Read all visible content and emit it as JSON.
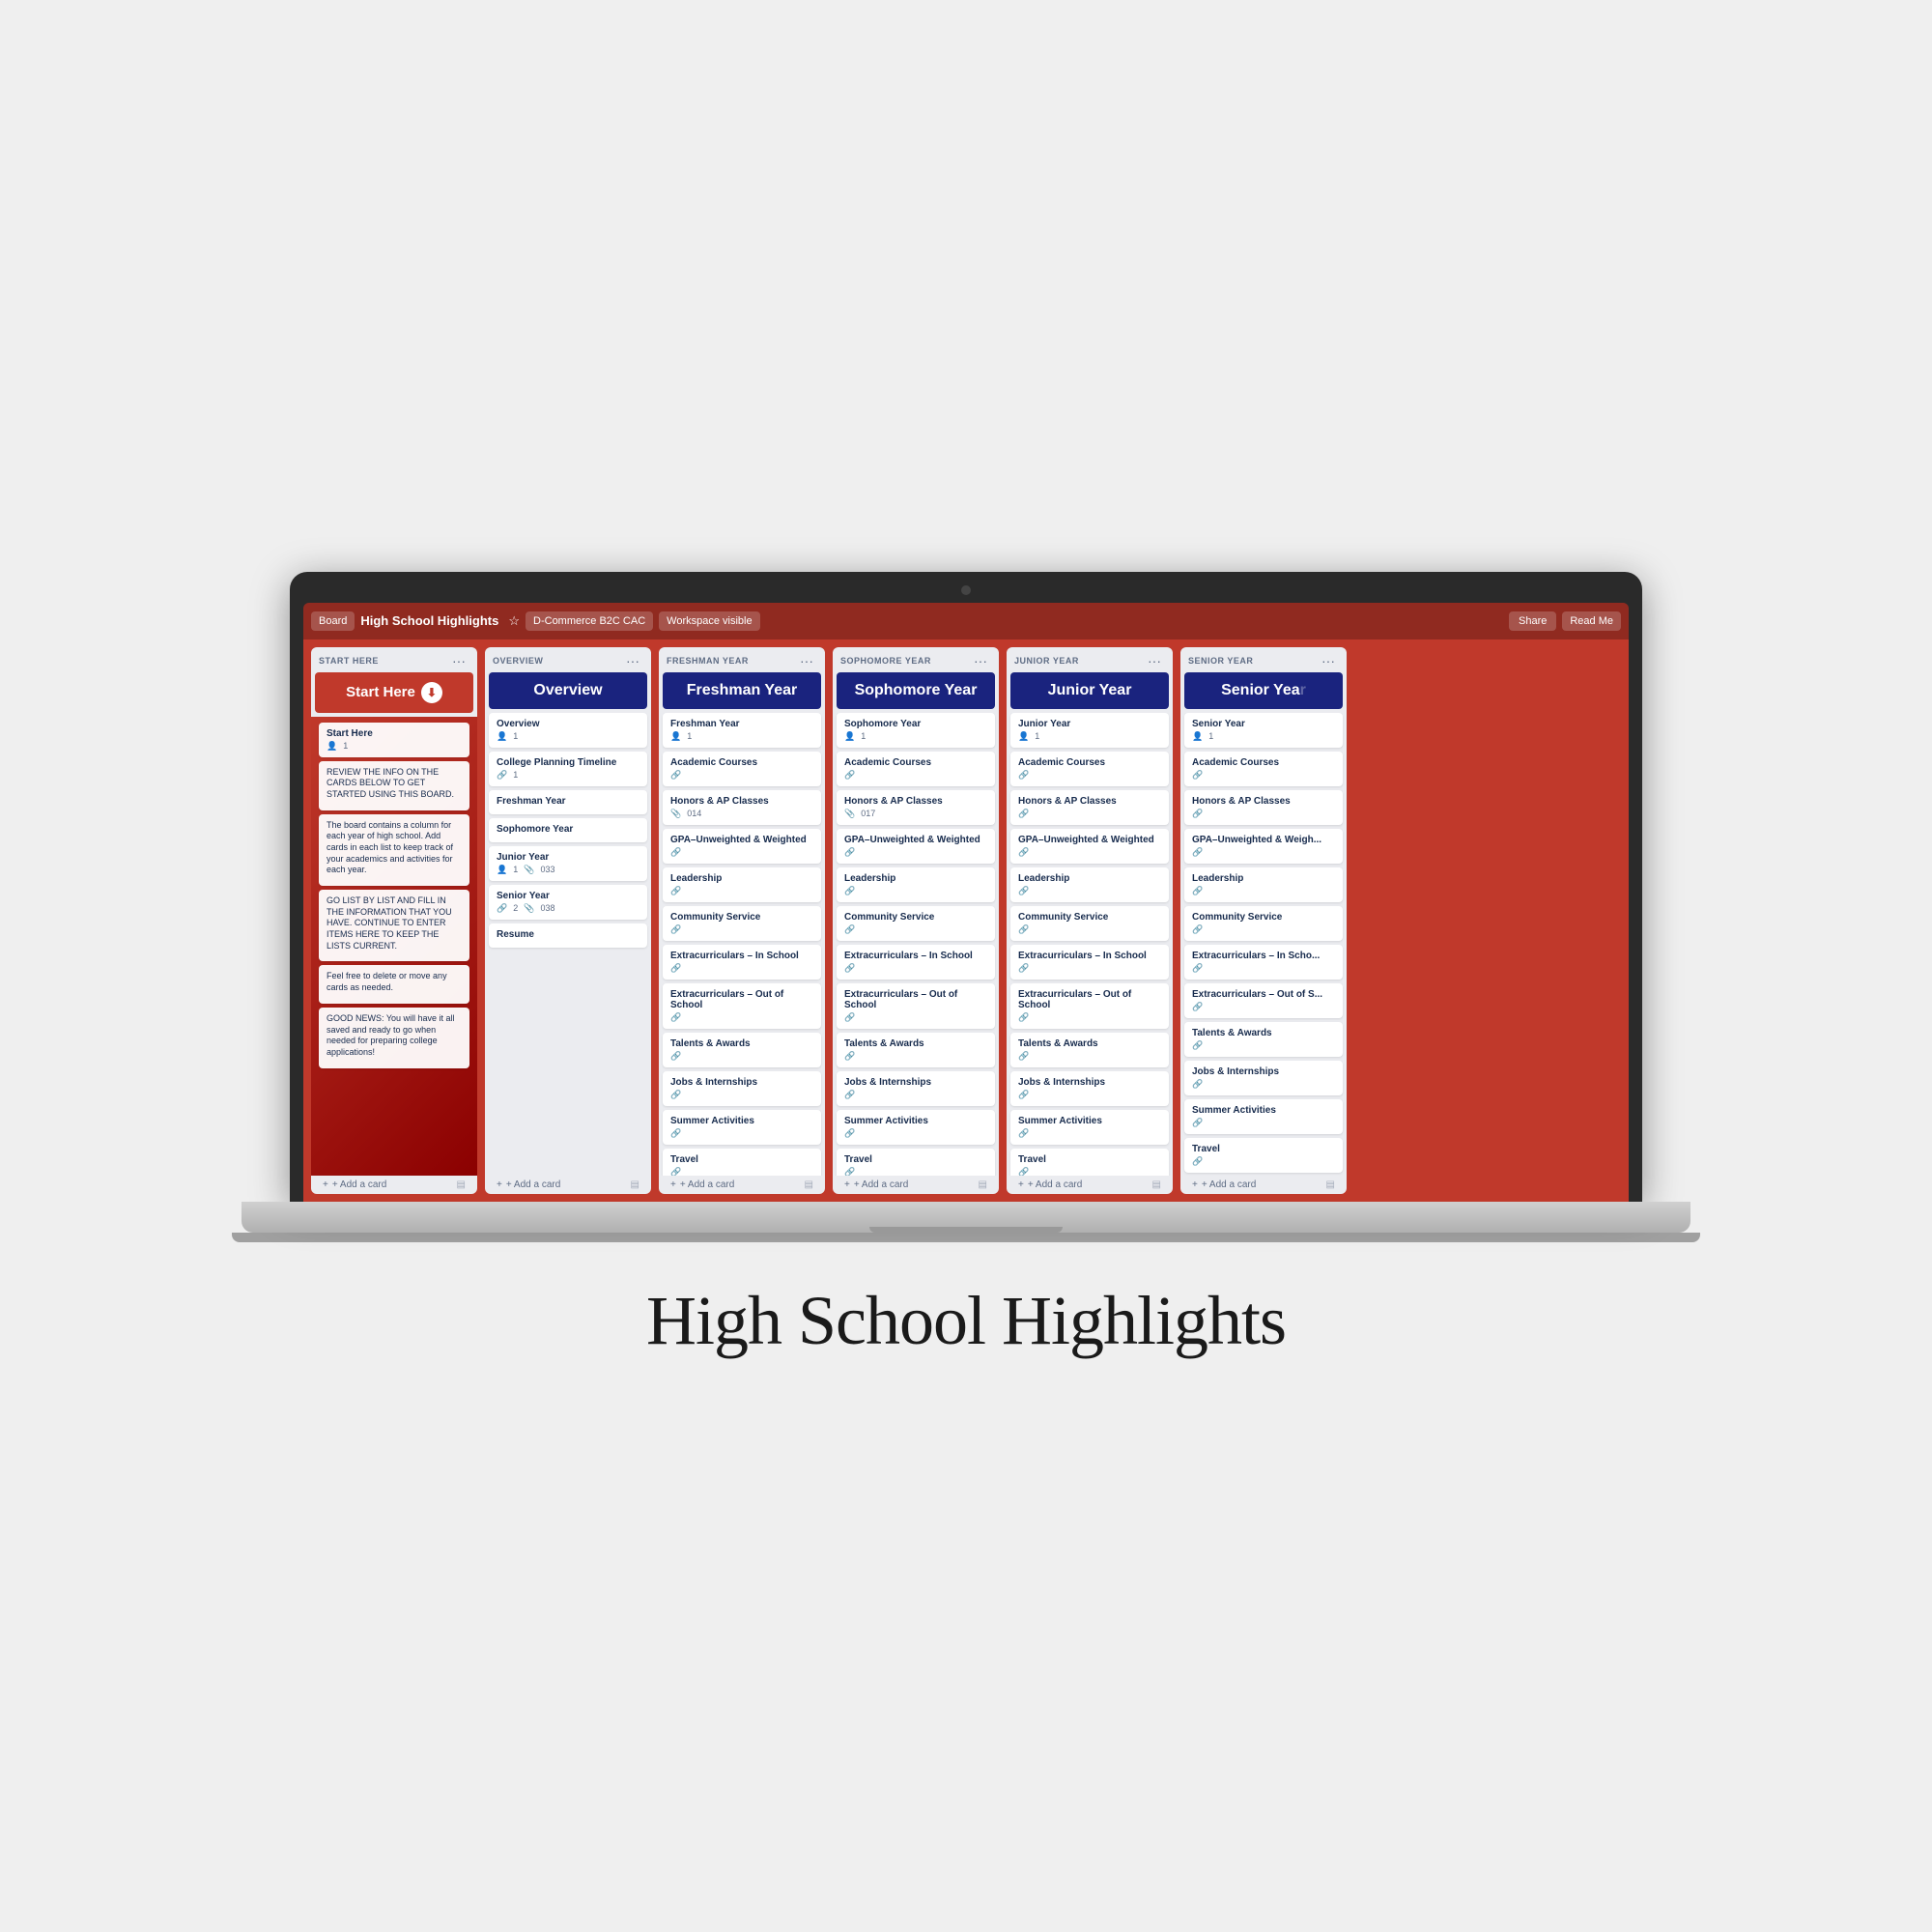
{
  "page": {
    "title": "High School Highlights",
    "background": "#efefef"
  },
  "topbar": {
    "board_btn": "Board",
    "board_title": "High School Highlights",
    "workspace_btn": "D-Commerce B2C CAC",
    "visibility_btn": "Workspace visible",
    "share_btn": "Share",
    "read_btn": "Read Me"
  },
  "columns": [
    {
      "id": "start-here",
      "label": "START HERE",
      "title": "Start Here",
      "title_icon": "⬇",
      "cards": [
        {
          "title": "Start Here",
          "meta": "1"
        },
        {
          "title": "REVIEW THE INFO ON THE CARDS BELOW TO GET STARTED USING THIS BOARD.",
          "body": true
        },
        {
          "title": "The board contains a column for each year of high school. Add cards in each list to keep track of your academics and activities for each year.",
          "body": true
        },
        {
          "title": "GO LIST BY LIST AND FILL IN THE INFORMATION THAT YOU HAVE. CONTINUE TO ENTER ITEMS HERE TO KEEP THE LISTS CURRENT.",
          "body": true
        },
        {
          "title": "Feel free to delete or move any cards as needed.",
          "body": true
        },
        {
          "title": "GOOD NEWS: You will have it all saved and ready to go when needed for preparing college applications!",
          "body": true
        }
      ]
    },
    {
      "id": "overview",
      "label": "OVERVIEW",
      "title": "Overview",
      "cards": [
        {
          "title": "Overview",
          "meta": "1"
        },
        {
          "title": "College Planning Timeline",
          "meta": "1"
        },
        {
          "title": "Freshman Year",
          "meta": ""
        },
        {
          "title": "Sophomore Year",
          "meta": ""
        },
        {
          "title": "Junior Year",
          "meta": "1 033"
        },
        {
          "title": "Senior Year",
          "meta": "2 038"
        },
        {
          "title": "Resume",
          "meta": ""
        }
      ]
    },
    {
      "id": "freshman",
      "label": "FRESHMAN YEAR",
      "title": "Freshman Year",
      "cards": [
        {
          "title": "Freshman Year",
          "meta": "1"
        },
        {
          "title": "Academic Courses",
          "meta": ""
        },
        {
          "title": "Honors & AP Classes",
          "meta": "014"
        },
        {
          "title": "GPA–Unweighted & Weighted",
          "meta": ""
        },
        {
          "title": "Leadership",
          "meta": ""
        },
        {
          "title": "Community Service",
          "meta": ""
        },
        {
          "title": "Extracurriculars – In School",
          "meta": ""
        },
        {
          "title": "Extracurriculars – Out of School",
          "meta": ""
        },
        {
          "title": "Talents & Awards",
          "meta": ""
        },
        {
          "title": "Jobs & Internships",
          "meta": ""
        },
        {
          "title": "Summer Activities",
          "meta": ""
        },
        {
          "title": "Travel",
          "meta": ""
        }
      ]
    },
    {
      "id": "sophomore",
      "label": "SOPHOMORE YEAR",
      "title": "Sophomore Year",
      "cards": [
        {
          "title": "Sophomore Year",
          "meta": "1"
        },
        {
          "title": "Academic Courses",
          "meta": ""
        },
        {
          "title": "Honors & AP Classes",
          "meta": "017"
        },
        {
          "title": "GPA–Unweighted & Weighted",
          "meta": ""
        },
        {
          "title": "Leadership",
          "meta": ""
        },
        {
          "title": "Community Service",
          "meta": ""
        },
        {
          "title": "Extracurriculars – In School",
          "meta": ""
        },
        {
          "title": "Extracurriculars – Out of School",
          "meta": ""
        },
        {
          "title": "Talents & Awards",
          "meta": ""
        },
        {
          "title": "Jobs & Internships",
          "meta": ""
        },
        {
          "title": "Summer Activities",
          "meta": ""
        },
        {
          "title": "Travel",
          "meta": ""
        }
      ]
    },
    {
      "id": "junior",
      "label": "JUNIOR YEAR",
      "title": "Junior Year",
      "cards": [
        {
          "title": "Junior Year",
          "meta": "1"
        },
        {
          "title": "Academic Courses",
          "meta": ""
        },
        {
          "title": "Honors & AP Classes",
          "meta": ""
        },
        {
          "title": "GPA–Unweighted & Weighted",
          "meta": ""
        },
        {
          "title": "Leadership",
          "meta": ""
        },
        {
          "title": "Community Service",
          "meta": ""
        },
        {
          "title": "Extracurriculars – In School",
          "meta": ""
        },
        {
          "title": "Extracurriculars – Out of School",
          "meta": ""
        },
        {
          "title": "Talents & Awards",
          "meta": ""
        },
        {
          "title": "Jobs & Internships",
          "meta": ""
        },
        {
          "title": "Summer Activities",
          "meta": ""
        },
        {
          "title": "Travel",
          "meta": ""
        }
      ]
    },
    {
      "id": "senior",
      "label": "SENIOR YEAR",
      "title": "Senior Year",
      "cards": [
        {
          "title": "Senior Year",
          "meta": "1"
        },
        {
          "title": "Academic Courses",
          "meta": ""
        },
        {
          "title": "Honors & AP Classes",
          "meta": ""
        },
        {
          "title": "GPA–Unweighted & Weighted",
          "meta": ""
        },
        {
          "title": "Leadership",
          "meta": ""
        },
        {
          "title": "Community Service",
          "meta": ""
        },
        {
          "title": "Extracurriculars – In School",
          "meta": ""
        },
        {
          "title": "Extracurriculars – Out of School",
          "meta": ""
        },
        {
          "title": "Talents & Awards",
          "meta": ""
        },
        {
          "title": "Jobs & Internships",
          "meta": ""
        },
        {
          "title": "Summer Activities",
          "meta": ""
        },
        {
          "title": "Travel",
          "meta": ""
        }
      ]
    }
  ],
  "add_card_label": "+ Add a card"
}
